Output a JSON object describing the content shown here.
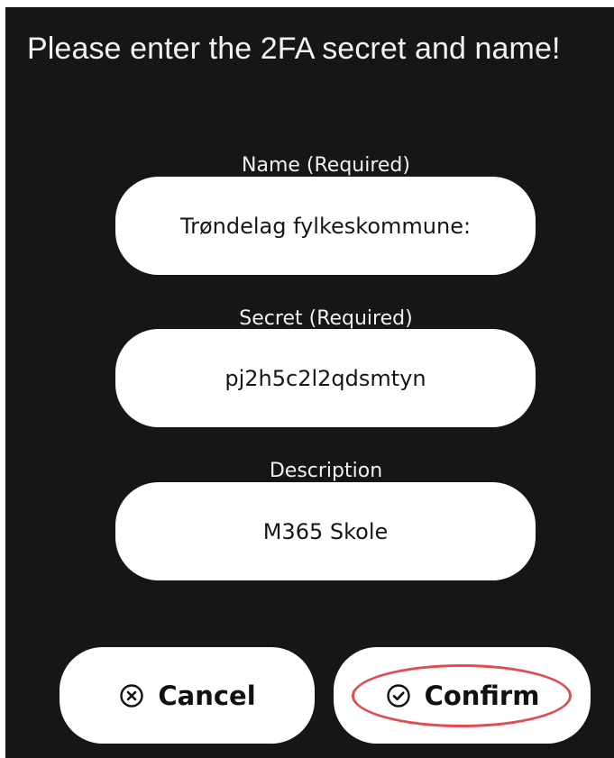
{
  "dialog": {
    "title": "Please enter the 2FA secret and name!"
  },
  "fields": {
    "name": {
      "label": "Name (Required)",
      "value": "Trøndelag fylkeskommune:"
    },
    "secret": {
      "label": "Secret (Required)",
      "value": "pj2h5c2l2qdsmtyn"
    },
    "description": {
      "label": "Description",
      "value": "M365 Skole"
    }
  },
  "buttons": {
    "cancel": {
      "label": "Cancel",
      "icon": "circle-x-icon"
    },
    "confirm": {
      "label": "Confirm",
      "icon": "circle-check-icon"
    }
  },
  "annotation": {
    "highlight_color": "#e24b50",
    "highlighted_element": "confirm"
  },
  "colors": {
    "dialog_background": "#161616",
    "text_light": "#f2f2f2",
    "input_background": "#ffffff",
    "button_background": "#ffffff"
  }
}
